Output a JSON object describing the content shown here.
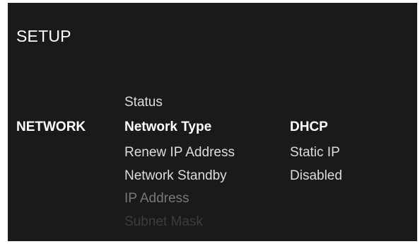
{
  "screen": {
    "title": "SETUP",
    "section": "NETWORK"
  },
  "menu": {
    "items": [
      {
        "label": "Status"
      },
      {
        "label": "Network Type"
      },
      {
        "label": "Renew IP Address"
      },
      {
        "label": "Network Standby"
      },
      {
        "label": "IP Address"
      },
      {
        "label": "Subnet Mask"
      }
    ],
    "selected": "Network Type"
  },
  "options": {
    "items": [
      {
        "label": "DHCP"
      },
      {
        "label": "Static IP"
      },
      {
        "label": "Disabled"
      }
    ],
    "selected": "DHCP"
  }
}
